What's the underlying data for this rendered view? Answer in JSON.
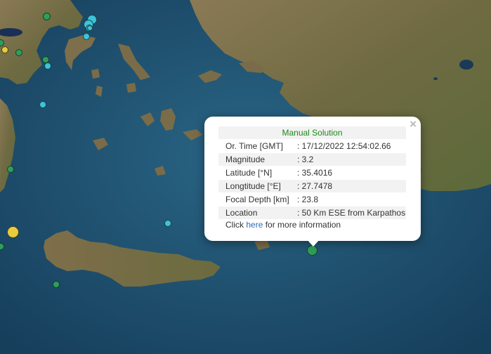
{
  "popup": {
    "title": "Manual Solution",
    "close_icon": "close-icon",
    "rows": [
      {
        "label": "Or. Time [GMT]",
        "value": ": 17/12/2022 12:54:02.66"
      },
      {
        "label": "Magnitude",
        "value": ": 3.2"
      },
      {
        "label": "Latitude [°N]",
        "value": ": 35.4016"
      },
      {
        "label": "Longtitude [°E]",
        "value": ": 27.7478"
      },
      {
        "label": "Focal Depth [km]",
        "value": ": 23.8"
      },
      {
        "label": "Location",
        "value": ": 50 Km ESE from Karpathos"
      }
    ],
    "more_prefix": "Click ",
    "more_link": "here",
    "more_suffix": " for more information"
  },
  "colors": {
    "sea": "#1d4d6e",
    "land": "#7a6a45",
    "quake_green": "#2e9e5a",
    "quake_cyan": "#3cc4dc",
    "quake_yellow": "#e8cc3c",
    "title_green": "#1a8a1a",
    "link_blue": "#2a6db8"
  },
  "quakes": [
    {
      "color": "quake_green"
    },
    {
      "color": "quake_cyan"
    },
    {
      "color": "quake_cyan"
    },
    {
      "color": "quake_cyan"
    },
    {
      "color": "quake_cyan"
    },
    {
      "color": "quake_cyan"
    },
    {
      "color": "quake_green"
    },
    {
      "color": "quake_yellow"
    },
    {
      "color": "quake_green"
    },
    {
      "color": "quake_green"
    },
    {
      "color": "quake_cyan"
    },
    {
      "color": "quake_cyan"
    },
    {
      "color": "quake_green"
    },
    {
      "color": "quake_yellow"
    },
    {
      "color": "quake_green"
    },
    {
      "color": "quake_cyan"
    },
    {
      "color": "quake_green"
    },
    {
      "color": "quake_green"
    }
  ]
}
